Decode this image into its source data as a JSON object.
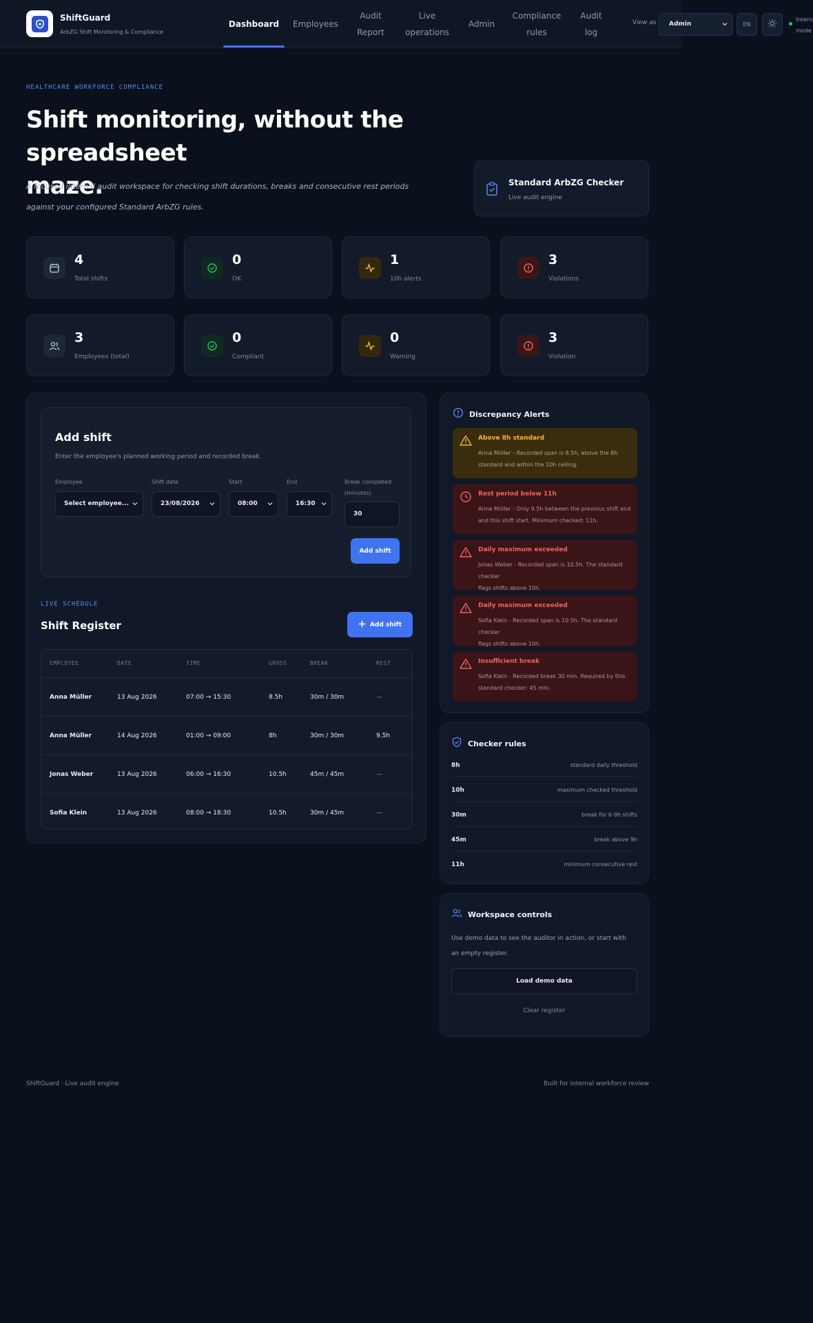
{
  "brand": {
    "name": "ShiftGuard",
    "tagline": "ArbZG Shift Monitoring & Compliance"
  },
  "nav": {
    "items": [
      {
        "line1": "Dashboard",
        "line2": ""
      },
      {
        "line1": "Employees",
        "line2": ""
      },
      {
        "line1": "Audit",
        "line2": "Report"
      },
      {
        "line1": "Live",
        "line2": "operations"
      },
      {
        "line1": "Admin",
        "line2": ""
      },
      {
        "line1": "Compliance",
        "line2": "rules"
      },
      {
        "line1": "Audit",
        "line2": "log"
      }
    ],
    "view_as_label": "View as",
    "role_value": "Admin",
    "lang": "EN",
    "status_line1": "Internal",
    "status_line2": "mode"
  },
  "hero": {
    "eyebrow": "HEALTHCARE WORKFORCE COMPLIANCE",
    "title_line1": "Shift monitoring, without the spreadsheet",
    "title_line2": "maze.",
    "subtitle_line1": "A focused internal audit workspace for checking shift durations, breaks and consecutive rest periods",
    "subtitle_line2": "against your configured Standard ArbZG rules.",
    "engine_title": "Standard ArbZG Checker",
    "engine_sub": "Live audit engine"
  },
  "stats": [
    {
      "value": "4",
      "label": "Total shifts"
    },
    {
      "value": "0",
      "label": "OK"
    },
    {
      "value": "1",
      "label": "10h alerts"
    },
    {
      "value": "3",
      "label": "Violations"
    },
    {
      "value": "3",
      "label": "Employees (total)"
    },
    {
      "value": "0",
      "label": "Compliant"
    },
    {
      "value": "0",
      "label": "Warning"
    },
    {
      "value": "3",
      "label": "Violation"
    }
  ],
  "add_shift": {
    "title": "Add shift",
    "subtitle": "Enter the employee's planned working period and recorded break.",
    "employee_label": "Employee",
    "employee_value": "Select employee...",
    "date_label": "Shift date",
    "date_value": "23/08/2026",
    "start_label": "Start",
    "start_value": "08:00",
    "end_label": "End",
    "end_value": "16:30",
    "break_label_line1": "Break completed",
    "break_label_line2": "(minutes)",
    "break_value": "30",
    "button": "Add shift"
  },
  "register": {
    "eyebrow": "LIVE SCHEDULE",
    "title": "Shift Register",
    "button": "Add shift",
    "columns": [
      "EMPLOYEE",
      "DATE",
      "TIME",
      "GROSS",
      "BREAK",
      "REST"
    ],
    "rows": [
      {
        "employee": "Anna Müller",
        "date": "13 Aug 2026",
        "time": "07:00 → 15:30",
        "gross": "8.5h",
        "break": "30m / 30m",
        "rest": "—"
      },
      {
        "employee": "Anna Müller",
        "date": "14 Aug 2026",
        "time": "01:00 → 09:00",
        "gross": "8h",
        "break": "30m / 30m",
        "rest": "9.5h"
      },
      {
        "employee": "Jonas Weber",
        "date": "13 Aug 2026",
        "time": "06:00 → 16:30",
        "gross": "10.5h",
        "break": "45m / 45m",
        "rest": "—"
      },
      {
        "employee": "Sofia Klein",
        "date": "13 Aug 2026",
        "time": "08:00 → 18:30",
        "gross": "10.5h",
        "break": "30m / 45m",
        "rest": "—"
      }
    ]
  },
  "discrepancy": {
    "title": "Discrepancy Alerts",
    "alerts": [
      {
        "kind": "amber",
        "title": "Above 8h standard",
        "line1": "Anna Müller - Recorded span is 8.5h, above the 8h",
        "line2": "standard and within the 10h ceiling."
      },
      {
        "kind": "red",
        "title": "Rest period below 11h",
        "line1": "Anna Müller - Only 9.5h between the previous shift end",
        "line2": "and this shift start. Minimum checked: 11h."
      },
      {
        "kind": "red",
        "title": "Daily maximum exceeded",
        "line1": "Jonas Weber - Recorded span is 10.5h. The standard checker",
        "line2": "flags shifts above 10h."
      },
      {
        "kind": "red",
        "title": "Daily maximum exceeded",
        "line1": "Sofia Klein - Recorded span is 10.5h. The standard checker",
        "line2": "flags shifts above 10h."
      },
      {
        "kind": "red",
        "title": "Insufficient break",
        "line1": "Sofia Klein - Recorded break 30 min. Required by this",
        "line2": "standard checker: 45 min."
      }
    ]
  },
  "rules": {
    "title": "Checker rules",
    "items": [
      {
        "key": "8h",
        "desc": "standard daily threshold"
      },
      {
        "key": "10h",
        "desc": "maximum checked threshold"
      },
      {
        "key": "30m",
        "desc": "break for 6-9h shifts"
      },
      {
        "key": "45m",
        "desc": "break above 9h"
      },
      {
        "key": "11h",
        "desc": "minimum consecutive rest"
      }
    ]
  },
  "workspace": {
    "title": "Workspace controls",
    "text_line1": "Use demo data to see the auditor in action, or start with",
    "text_line2": "an empty register.",
    "load": "Load demo data",
    "clear": "Clear register"
  },
  "footer": {
    "left": "ShiftGuard · Live audit engine",
    "right": "Built for internal workforce review"
  },
  "colors": {
    "accent": "#3f73f0",
    "ok": "#22c55e",
    "warning": "#f5b53d",
    "violation": "#f2635d",
    "background": "#0b111c"
  }
}
